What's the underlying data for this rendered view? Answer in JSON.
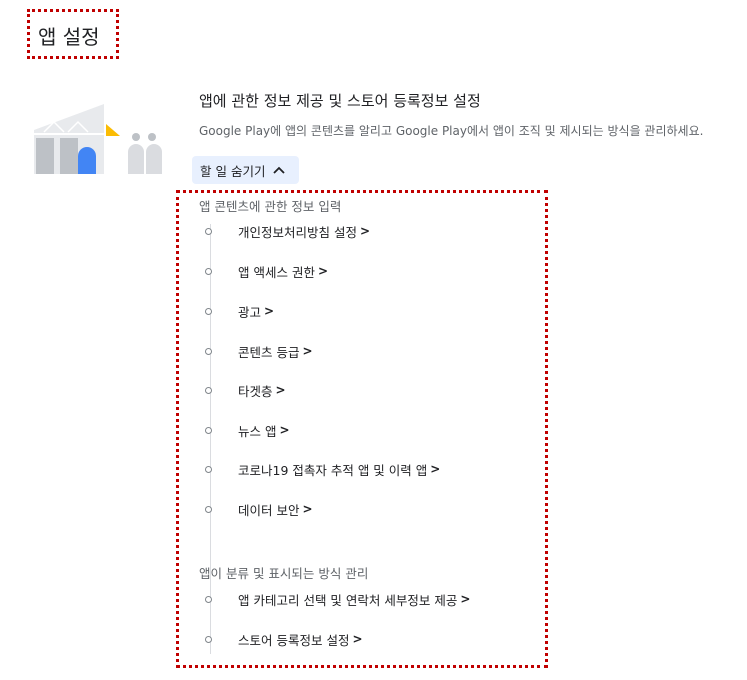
{
  "page": {
    "title": "앱 설정"
  },
  "intro": {
    "heading": "앱에 관한 정보 제공 및 스토어 등록정보 설정",
    "description": "Google Play에 앱의 콘텐츠를 알리고 Google Play에서 앱이 조직 및 제시되는 방식을 관리하세요."
  },
  "toggle": {
    "label": "할 일 숨기기",
    "icon": "chevron-up-icon"
  },
  "sections": [
    {
      "label": "앱 콘텐츠에 관한 정보 입력",
      "steps": [
        {
          "label": "개인정보처리방침 설정",
          "arrow": ">"
        },
        {
          "label": "앱 액세스 권한",
          "arrow": ">"
        },
        {
          "label": "광고",
          "arrow": ">"
        },
        {
          "label": "콘텐츠 등급",
          "arrow": ">"
        },
        {
          "label": "타겟층",
          "arrow": ">"
        },
        {
          "label": "뉴스 앱",
          "arrow": ">"
        },
        {
          "label": "코로나19 접촉자 추적 앱 및 이력 앱",
          "arrow": ">"
        },
        {
          "label": "데이터 보안",
          "arrow": ">"
        }
      ]
    },
    {
      "label": "앱이 분류 및 표시되는 방식 관리",
      "steps": [
        {
          "label": "앱 카테고리 선택 및 연락처 세부정보 제공",
          "arrow": ">"
        },
        {
          "label": "스토어 등록정보 설정",
          "arrow": ">"
        }
      ]
    }
  ],
  "colors": {
    "annotation": "#c00000",
    "toggle_bg": "#e8f0fe",
    "illus_blue": "#4285f4",
    "illus_yellow": "#fbbc04",
    "illus_gray": "#dadce0"
  }
}
